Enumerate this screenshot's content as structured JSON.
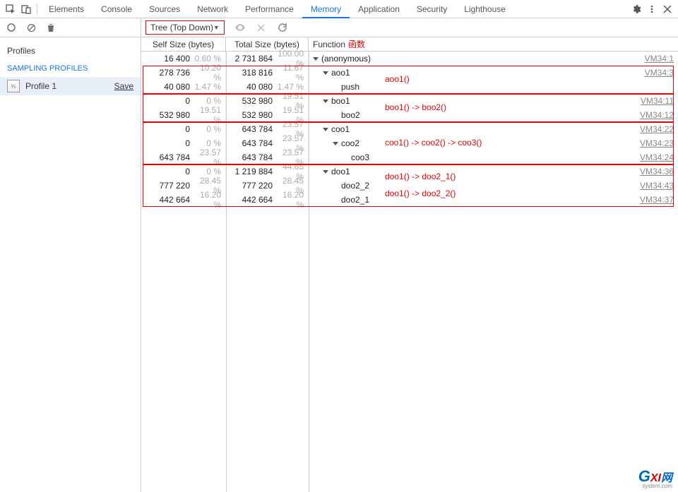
{
  "tabs": {
    "items": [
      "Elements",
      "Console",
      "Sources",
      "Network",
      "Performance",
      "Memory",
      "Application",
      "Security",
      "Lighthouse"
    ],
    "active": "Memory"
  },
  "dropdown": {
    "label": "Tree (Top Down)"
  },
  "sidebar": {
    "heading": "Profiles",
    "subheading": "SAMPLING PROFILES",
    "profileName": "Profile 1",
    "saveLabel": "Save"
  },
  "columns": {
    "self": "Self Size (bytes)",
    "total": "Total Size (bytes)",
    "func": "Function",
    "funcHanzi": "函数"
  },
  "rows": [
    {
      "self": "16 400",
      "selfPct": "0.60 %",
      "total": "2 731 864",
      "totalPct": "100.00 %",
      "indent": 0,
      "tri": true,
      "name": "(anonymous)",
      "link": "VM34:1"
    },
    {
      "self": "278 736",
      "selfPct": "10.20 %",
      "total": "318 816",
      "totalPct": "11.67 %",
      "indent": 1,
      "tri": true,
      "name": "aoo1",
      "link": "VM34:3"
    },
    {
      "self": "40 080",
      "selfPct": "1.47 %",
      "total": "40 080",
      "totalPct": "1.47 %",
      "indent": 2,
      "tri": false,
      "name": "push",
      "link": ""
    },
    {
      "self": "0",
      "selfPct": "0 %",
      "total": "532 980",
      "totalPct": "19.51 %",
      "indent": 1,
      "tri": true,
      "name": "boo1",
      "link": "VM34:11"
    },
    {
      "self": "532 980",
      "selfPct": "19.51 %",
      "total": "532 980",
      "totalPct": "19.51 %",
      "indent": 2,
      "tri": false,
      "name": "boo2",
      "link": "VM34:12"
    },
    {
      "self": "0",
      "selfPct": "0 %",
      "total": "643 784",
      "totalPct": "23.57 %",
      "indent": 1,
      "tri": true,
      "name": "coo1",
      "link": "VM34:22"
    },
    {
      "self": "0",
      "selfPct": "0 %",
      "total": "643 784",
      "totalPct": "23.57 %",
      "indent": 2,
      "tri": true,
      "name": "coo2",
      "link": "VM34:23"
    },
    {
      "self": "643 784",
      "selfPct": "23.57 %",
      "total": "643 784",
      "totalPct": "23.57 %",
      "indent": 3,
      "tri": false,
      "name": "coo3",
      "link": "VM34:24"
    },
    {
      "self": "0",
      "selfPct": "0 %",
      "total": "1 219 884",
      "totalPct": "44.65 %",
      "indent": 1,
      "tri": true,
      "name": "doo1",
      "link": "VM34:36"
    },
    {
      "self": "777 220",
      "selfPct": "28.45 %",
      "total": "777 220",
      "totalPct": "28.45 %",
      "indent": 2,
      "tri": false,
      "name": "doo2_2",
      "link": "VM34:43"
    },
    {
      "self": "442 664",
      "selfPct": "16.20 %",
      "total": "442 664",
      "totalPct": "16.20 %",
      "indent": 2,
      "tri": false,
      "name": "doo2_1",
      "link": "VM34:37"
    }
  ],
  "annots": {
    "a1": "aoo1()",
    "a2": "boo1() -> boo2()",
    "a3": "coo1() -> coo2() -> coo3()",
    "a4": "doo1() -> doo2_1()",
    "a5": "doo1() -> doo2_2()"
  },
  "watermark": {
    "g": "G",
    "xi": "XI",
    "wang": "网",
    "sys": "system.com"
  }
}
